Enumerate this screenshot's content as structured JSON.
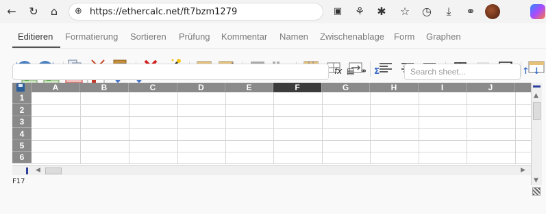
{
  "browser": {
    "url": "https://ethercalc.net/ft7bzm1279",
    "icons": [
      "back-icon",
      "reload-icon",
      "home-icon",
      "globe-icon",
      "office-icon",
      "extensions-icon",
      "puzzle-icon",
      "favorites-icon",
      "history-icon",
      "downloads-icon",
      "collections-icon",
      "profile-avatar",
      "copilot-icon"
    ]
  },
  "tabs": [
    {
      "label": "Editieren",
      "active": true
    },
    {
      "label": "Formatierung",
      "active": false
    },
    {
      "label": "Sortieren",
      "active": false
    },
    {
      "label": "Prüfung",
      "active": false
    },
    {
      "label": "Kommentar",
      "active": false
    },
    {
      "label": "Namen",
      "active": false
    },
    {
      "label": "Zwischenablage",
      "active": false
    },
    {
      "label": "Form",
      "active": false
    },
    {
      "label": "Graphen",
      "active": false
    }
  ],
  "toolbar": {
    "icons": [
      "undo-icon",
      "redo-icon",
      "copy-icon",
      "cut-icon",
      "paste-icon",
      "delete-icon",
      "magic-wand-icon",
      "lock-cell-icon",
      "edit-range-icon",
      "insert-row-icon",
      "insert-column-icon",
      "table-icon",
      "merge-icon",
      "unmerge-icon",
      "align-left-icon",
      "align-center-icon",
      "align-right-icon",
      "borders-icon",
      "no-border-icon",
      "swap-colors-icon",
      "table-more-icon",
      "insert-row-above-icon",
      "insert-column-left-icon",
      "delete-row-icon",
      "delete-column-icon",
      "pause-calc-icon",
      "filter-icon"
    ]
  },
  "formula_bar": {
    "value": "",
    "fx_label": "fx",
    "sum_label": "Σ"
  },
  "search": {
    "placeholder": "Search sheet..."
  },
  "grid": {
    "columns": [
      "A",
      "B",
      "C",
      "D",
      "E",
      "F",
      "G",
      "H",
      "I",
      "J"
    ],
    "selected_column": "F",
    "rows": [
      "1",
      "2",
      "3",
      "4",
      "5",
      "6"
    ]
  },
  "status": {
    "cell_ref": "F17"
  }
}
